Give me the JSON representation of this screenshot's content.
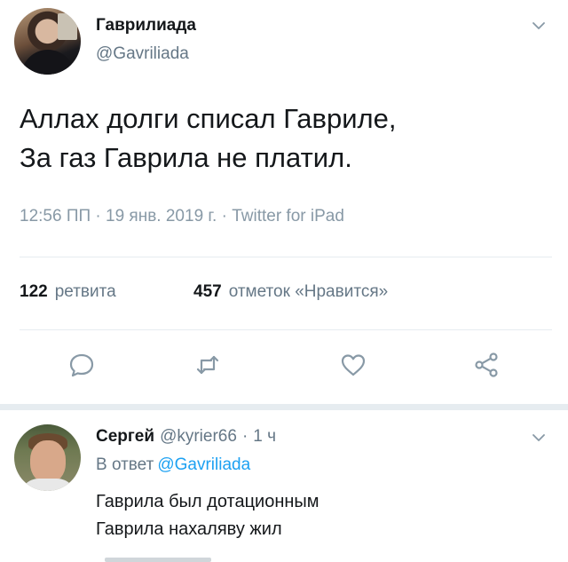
{
  "tweet": {
    "author_name": "Гаврилиада",
    "author_handle": "@Gavriliada",
    "text": "Аллах долги списал Гавриле,\nЗа газ Гаврила не платил.",
    "meta": "12:56 ПП · 19 янв. 2019 г. · Twitter for iPad",
    "retweets_count": "122",
    "retweets_label": "ретвита",
    "likes_count": "457",
    "likes_label": "отметок «Нравится»"
  },
  "reply": {
    "author_name": "Сергей",
    "author_handle": "@kyrier66",
    "separator": "·",
    "time": "1 ч",
    "reply_to_label": "В ответ",
    "reply_to_handle": "@Gavriliada",
    "text": "Гаврила был дотационным\nГаврила нахаляву жил"
  },
  "icons": [
    "chevron-down-icon",
    "reply-icon",
    "retweet-icon",
    "like-icon",
    "share-icon"
  ],
  "colors": {
    "text": "#14171a",
    "secondary": "#657786",
    "link": "#1da1f2",
    "divider": "#e6ecf0"
  }
}
